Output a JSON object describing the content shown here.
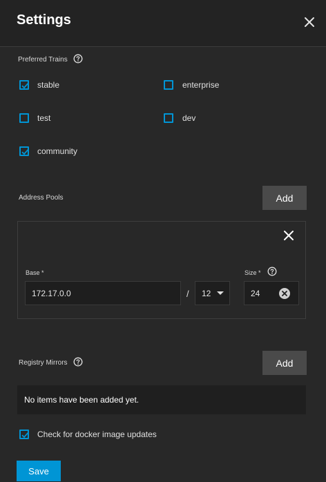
{
  "header": {
    "title": "Settings",
    "close_icon": "close-icon"
  },
  "trains": {
    "label": "Preferred Trains",
    "options": [
      {
        "label": "stable",
        "checked": true
      },
      {
        "label": "enterprise",
        "checked": false
      },
      {
        "label": "test",
        "checked": false
      },
      {
        "label": "dev",
        "checked": false
      },
      {
        "label": "community",
        "checked": true
      }
    ]
  },
  "address_pools": {
    "label": "Address Pools",
    "add_label": "Add",
    "items": [
      {
        "base_label": "Base *",
        "base_value": "172.17.0.0",
        "separator": "/",
        "netmask_value": "12",
        "size_label": "Size *",
        "size_value": "24"
      }
    ]
  },
  "registry_mirrors": {
    "label": "Registry Mirrors",
    "add_label": "Add",
    "empty_text": "No items have been added yet."
  },
  "docker_updates": {
    "label": "Check for docker image updates",
    "checked": true
  },
  "footer": {
    "save_label": "Save"
  },
  "colors": {
    "accent": "#0095d5",
    "background": "#282828",
    "button": "#4a4a4a"
  }
}
